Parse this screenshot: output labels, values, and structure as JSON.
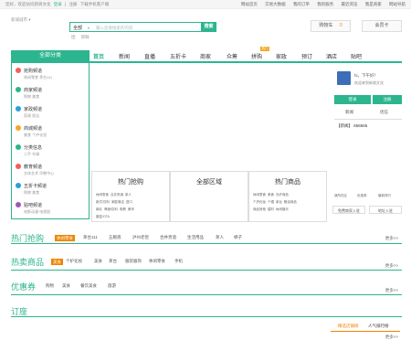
{
  "topbar": {
    "greeting": "您好，欢迎访问新商文化",
    "login": "登录",
    "register": "注册",
    "download": "下载手机客户端",
    "links": [
      "网站首页",
      "交易大数据",
      "我的订单",
      "我的服务",
      "最近浏览",
      "我是商家",
      "网站导航"
    ]
  },
  "header": {
    "city": "新城城市 ▾",
    "search_category": "全部",
    "search_placeholder": "输入您要搜索的内容",
    "search_button": "搜索",
    "hot_words": [
      "团",
      "新鲜"
    ],
    "cart_button": "购物车",
    "cart_count": "0",
    "member_button": "会员卡"
  },
  "nav": {
    "all_categories": "全部分类",
    "items": [
      "首页",
      "新闻",
      "直播",
      "五折卡",
      "商家",
      "众筹",
      "拼购",
      "家政",
      "预订",
      "酒店",
      "贴吧"
    ],
    "badge": "热门"
  },
  "sidebar": [
    {
      "title": "抢购频道",
      "sub": "休闲零食  茅台111",
      "color": "#f06060"
    },
    {
      "title": "商家频道",
      "sub": "购物  美食",
      "color": "#2cb58e"
    },
    {
      "title": "家政频道",
      "sub": "家政  保洁",
      "color": "#29a0db"
    },
    {
      "title": "商城频道",
      "sub": "美食  个护化妆",
      "color": "#f5a623"
    },
    {
      "title": "分类信息",
      "sub": "二手  车辆",
      "color": "#2cb58e"
    },
    {
      "title": "教育频道",
      "sub": "文体艺术  早教中心",
      "color": "#f06060"
    },
    {
      "title": "五折卡频道",
      "sub": "购物  美食",
      "color": "#29a0db"
    },
    {
      "title": "贴吧频道",
      "sub": "电影动漫  电视剧",
      "color": "#9b59b6"
    }
  ],
  "user_panel": {
    "hi": "hi，下午好！",
    "welcome": "欢迎来到新商文化",
    "login": "登录",
    "register": "注册",
    "links": [
      "新闻",
      "优信"
    ],
    "notice": "【新闻】 656565"
  },
  "mid_boxes": [
    {
      "title": "热门抢购",
      "links": [
        "休闲零食",
        "合并贵酒",
        "茅人",
        "新式/饮料",
        "家庭清洁",
        "进口",
        "裤衫",
        "啤酒/饮料",
        "电教",
        "美甲",
        "康复/OTA"
      ]
    },
    {
      "title": "全部区域",
      "links": []
    },
    {
      "title": "热门商品",
      "links": [
        "休闲零食",
        "美食",
        "光纤商品",
        "个护化妆",
        "个帽",
        "茅台",
        "粮油商品",
        "商品其他",
        "建材",
        "休闲娱乐"
      ]
    }
  ],
  "right_links": [
    "我所在区",
    "优惠券",
    "最新排行"
  ],
  "right_buttons": [
    "免费商家入驻",
    "地址入驻"
  ],
  "sections": [
    {
      "title": "热门抢购",
      "tags": [
        "休闲零食",
        "茅台111",
        "五粮液",
        "泸州老窖",
        "合并贵酒",
        "生活用品",
        "茅人",
        "梯子"
      ],
      "active": 0,
      "more": "更多>>"
    },
    {
      "title": "热卖商品",
      "tags": [
        "美食",
        "个护化妆",
        "美食",
        "茅台",
        "服装服饰",
        "休闲零食",
        "手机"
      ],
      "active": 0,
      "more": "更多>>"
    },
    {
      "title": "优惠券",
      "tags": [
        "购物",
        "美食",
        "餐饮美食",
        "旅游"
      ],
      "active": -1,
      "more": "更多>>"
    },
    {
      "title": "订座",
      "tags": [],
      "active": -1,
      "more": ""
    }
  ],
  "rank_tabs": [
    "精选店铺榜",
    "人气排行榜"
  ],
  "rank_more": "更多>>",
  "colors": {
    "accent": "#2cb58e",
    "orange": "#f08300"
  }
}
